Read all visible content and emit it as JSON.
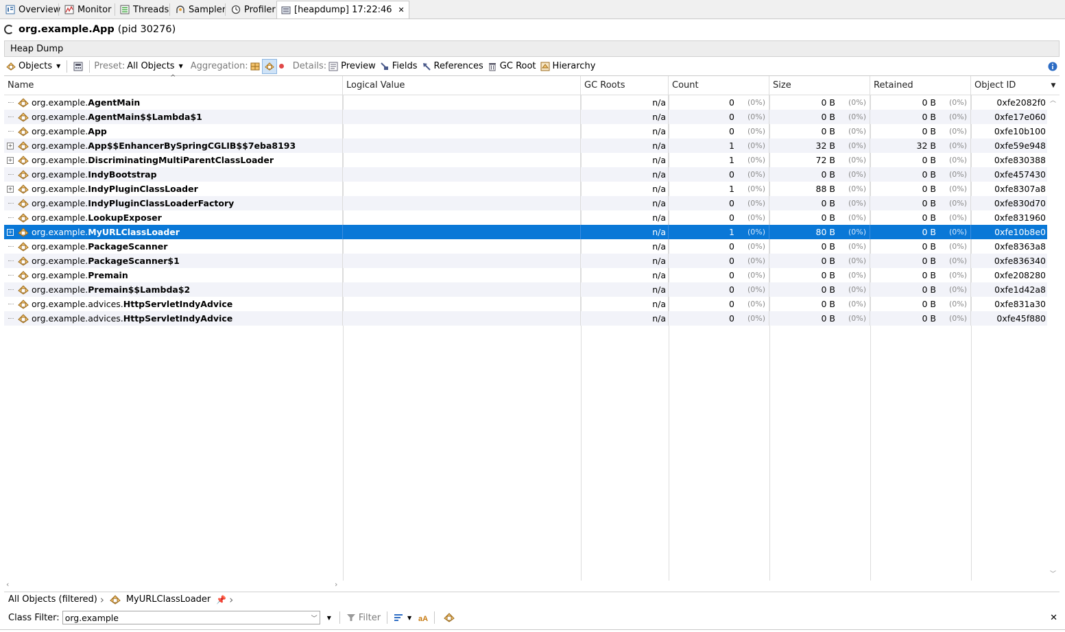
{
  "tabs": [
    {
      "label": "Overview",
      "icon": "overview-icon"
    },
    {
      "label": "Monitor",
      "icon": "monitor-icon"
    },
    {
      "label": "Threads",
      "icon": "threads-icon"
    },
    {
      "label": "Sampler",
      "icon": "sampler-icon"
    },
    {
      "label": "Profiler",
      "icon": "profiler-icon"
    },
    {
      "label": "[heapdump] 17:22:46",
      "icon": "heapdump-icon",
      "close": "✕"
    }
  ],
  "app": {
    "name": "org.example.App",
    "pid": "(pid 30276)"
  },
  "section_title": "Heap Dump",
  "toolbar": {
    "objects_label": "Objects",
    "preset_label": "Preset:",
    "preset_value": "All Objects",
    "aggregation_label": "Aggregation:",
    "details_label": "Details:",
    "preview_label": "Preview",
    "fields_label": "Fields",
    "references_label": "References",
    "gcroot_label": "GC Root",
    "hierarchy_label": "Hierarchy"
  },
  "columns": [
    "Name",
    "Logical Value",
    "GC Roots",
    "Count",
    "Size",
    "Retained",
    "Object ID"
  ],
  "rows": [
    {
      "pkg": "org.example.",
      "cls": "AgentMain",
      "expandable": false,
      "gc": "n/a",
      "count": "0",
      "count_pct": "(0%)",
      "size": "0 B",
      "size_pct": "(0%)",
      "retained": "0 B",
      "retained_pct": "(0%)",
      "oid": "0xfe2082f0"
    },
    {
      "pkg": "org.example.",
      "cls": "AgentMain$$Lambda$1",
      "expandable": false,
      "gc": "n/a",
      "count": "0",
      "count_pct": "(0%)",
      "size": "0 B",
      "size_pct": "(0%)",
      "retained": "0 B",
      "retained_pct": "(0%)",
      "oid": "0xfe17e060"
    },
    {
      "pkg": "org.example.",
      "cls": "App",
      "expandable": false,
      "gc": "n/a",
      "count": "0",
      "count_pct": "(0%)",
      "size": "0 B",
      "size_pct": "(0%)",
      "retained": "0 B",
      "retained_pct": "(0%)",
      "oid": "0xfe10b100"
    },
    {
      "pkg": "org.example.",
      "cls": "App$$EnhancerBySpringCGLIB$$7eba8193",
      "expandable": true,
      "gc": "n/a",
      "count": "1",
      "count_pct": "(0%)",
      "size": "32 B",
      "size_pct": "(0%)",
      "retained": "32 B",
      "retained_pct": "(0%)",
      "oid": "0xfe59e948"
    },
    {
      "pkg": "org.example.",
      "cls": "DiscriminatingMultiParentClassLoader",
      "expandable": true,
      "gc": "n/a",
      "count": "1",
      "count_pct": "(0%)",
      "size": "72 B",
      "size_pct": "(0%)",
      "retained": "0 B",
      "retained_pct": "(0%)",
      "oid": "0xfe830388"
    },
    {
      "pkg": "org.example.",
      "cls": "IndyBootstrap",
      "expandable": false,
      "gc": "n/a",
      "count": "0",
      "count_pct": "(0%)",
      "size": "0 B",
      "size_pct": "(0%)",
      "retained": "0 B",
      "retained_pct": "(0%)",
      "oid": "0xfe457430"
    },
    {
      "pkg": "org.example.",
      "cls": "IndyPluginClassLoader",
      "expandable": true,
      "gc": "n/a",
      "count": "1",
      "count_pct": "(0%)",
      "size": "88 B",
      "size_pct": "(0%)",
      "retained": "0 B",
      "retained_pct": "(0%)",
      "oid": "0xfe8307a8"
    },
    {
      "pkg": "org.example.",
      "cls": "IndyPluginClassLoaderFactory",
      "expandable": false,
      "gc": "n/a",
      "count": "0",
      "count_pct": "(0%)",
      "size": "0 B",
      "size_pct": "(0%)",
      "retained": "0 B",
      "retained_pct": "(0%)",
      "oid": "0xfe830d70"
    },
    {
      "pkg": "org.example.",
      "cls": "LookupExposer",
      "expandable": false,
      "gc": "n/a",
      "count": "0",
      "count_pct": "(0%)",
      "size": "0 B",
      "size_pct": "(0%)",
      "retained": "0 B",
      "retained_pct": "(0%)",
      "oid": "0xfe831960"
    },
    {
      "pkg": "org.example.",
      "cls": "MyURLClassLoader",
      "expandable": true,
      "selected": true,
      "gc": "n/a",
      "count": "1",
      "count_pct": "(0%)",
      "size": "80 B",
      "size_pct": "(0%)",
      "retained": "0 B",
      "retained_pct": "(0%)",
      "oid": "0xfe10b8e0"
    },
    {
      "pkg": "org.example.",
      "cls": "PackageScanner",
      "expandable": false,
      "gc": "n/a",
      "count": "0",
      "count_pct": "(0%)",
      "size": "0 B",
      "size_pct": "(0%)",
      "retained": "0 B",
      "retained_pct": "(0%)",
      "oid": "0xfe8363a8"
    },
    {
      "pkg": "org.example.",
      "cls": "PackageScanner$1",
      "expandable": false,
      "gc": "n/a",
      "count": "0",
      "count_pct": "(0%)",
      "size": "0 B",
      "size_pct": "(0%)",
      "retained": "0 B",
      "retained_pct": "(0%)",
      "oid": "0xfe836340"
    },
    {
      "pkg": "org.example.",
      "cls": "Premain",
      "expandable": false,
      "gc": "n/a",
      "count": "0",
      "count_pct": "(0%)",
      "size": "0 B",
      "size_pct": "(0%)",
      "retained": "0 B",
      "retained_pct": "(0%)",
      "oid": "0xfe208280"
    },
    {
      "pkg": "org.example.",
      "cls": "Premain$$Lambda$2",
      "expandable": false,
      "gc": "n/a",
      "count": "0",
      "count_pct": "(0%)",
      "size": "0 B",
      "size_pct": "(0%)",
      "retained": "0 B",
      "retained_pct": "(0%)",
      "oid": "0xfe1d42a8"
    },
    {
      "pkg": "org.example.advices.",
      "cls": "HttpServletIndyAdvice",
      "expandable": false,
      "gc": "n/a",
      "count": "0",
      "count_pct": "(0%)",
      "size": "0 B",
      "size_pct": "(0%)",
      "retained": "0 B",
      "retained_pct": "(0%)",
      "oid": "0xfe831a30"
    },
    {
      "pkg": "org.example.advices.",
      "cls": "HttpServletIndyAdvice",
      "expandable": false,
      "gc": "n/a",
      "count": "0",
      "count_pct": "(0%)",
      "size": "0 B",
      "size_pct": "(0%)",
      "retained": "0 B",
      "retained_pct": "(0%)",
      "oid": "0xfe45f880"
    }
  ],
  "breadcrumb": {
    "root": "All Objects (filtered)",
    "current": "MyURLClassLoader"
  },
  "filter": {
    "label": "Class Filter:",
    "value": "org.example",
    "button_label": "Filter"
  },
  "colors": {
    "selection": "#0a78d7",
    "class_icon": "#e8a33a"
  }
}
